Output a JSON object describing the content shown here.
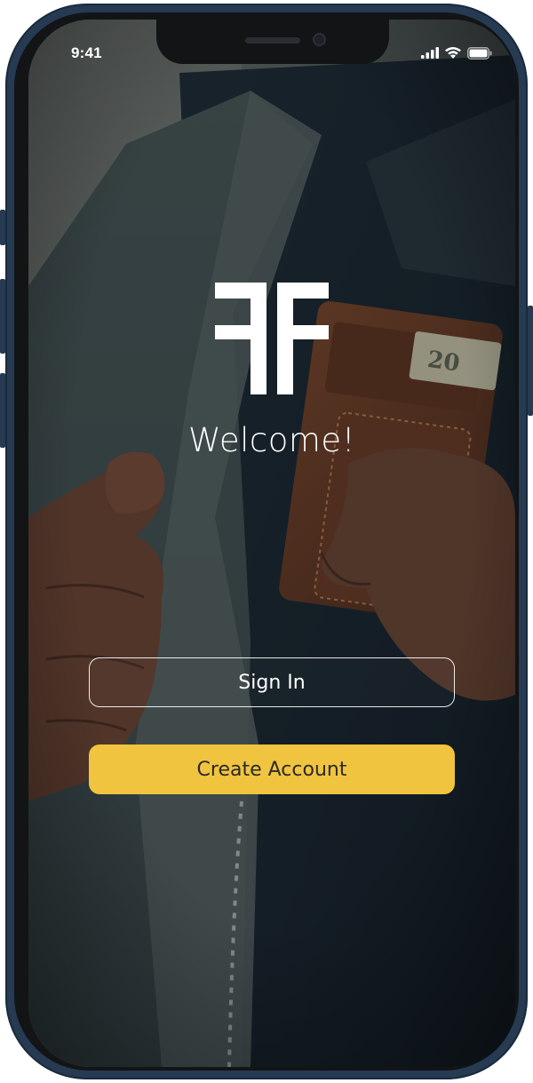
{
  "status_bar": {
    "time": "9:41",
    "icons": [
      "signal-icon",
      "wifi-icon",
      "battery-icon"
    ]
  },
  "brand": {
    "logo_icon": "double-f-logo-icon"
  },
  "welcome": {
    "title": "Welcome!"
  },
  "actions": {
    "sign_in_label": "Sign In",
    "create_account_label": "Create Account"
  },
  "colors": {
    "accent": "#f1c43f",
    "frame": "#263a52"
  }
}
